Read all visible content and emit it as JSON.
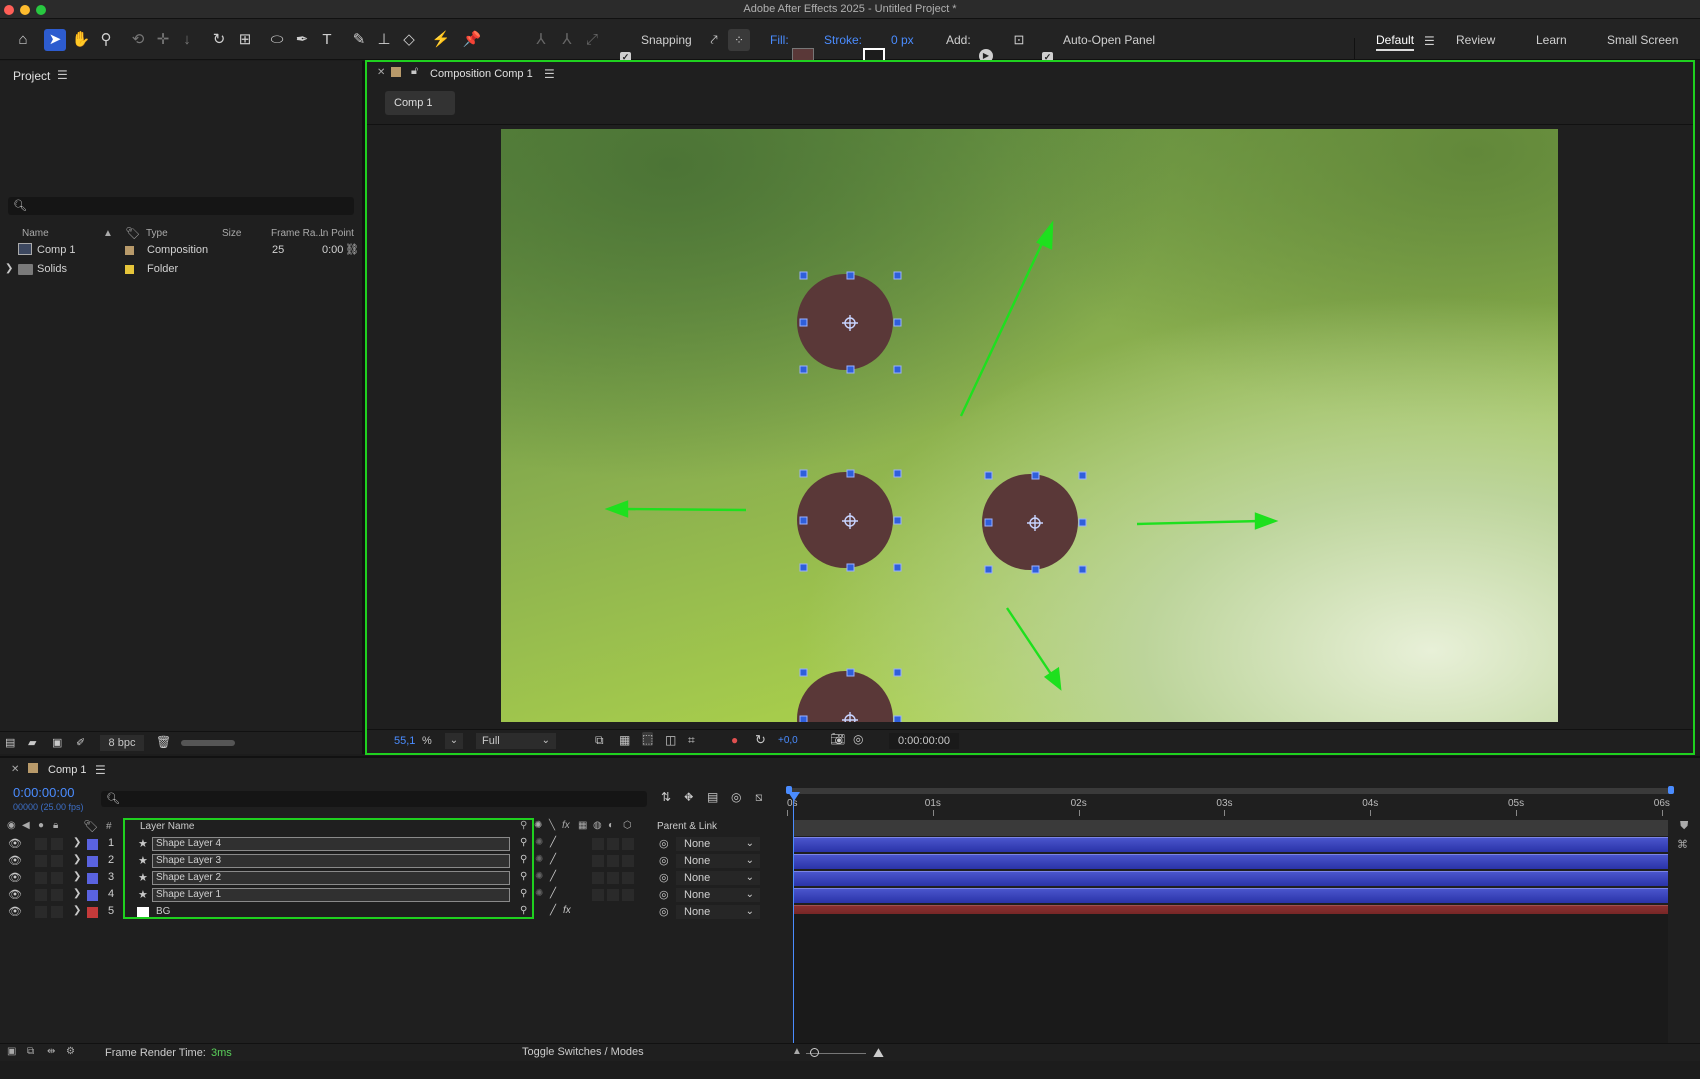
{
  "app": {
    "title": "Adobe After Effects 2025 - Untitled Project *"
  },
  "toolbar": {
    "snapping_label": "Snapping",
    "fill_label": "Fill:",
    "stroke_label": "Stroke:",
    "stroke_width": "0 px",
    "add_label": "Add:",
    "auto_open_label": "Auto-Open Panel",
    "fill_color": "#5a3838"
  },
  "workspaces": [
    "Default",
    "Review",
    "Learn",
    "Small Screen"
  ],
  "project": {
    "panel_title": "Project",
    "columns": {
      "name": "Name",
      "type": "Type",
      "size": "Size",
      "frame_rate": "Frame Ra...",
      "in_point": "In Point"
    },
    "items": [
      {
        "name": "Comp 1",
        "type": "Composition",
        "frame_rate": "25",
        "in_point": "0:00",
        "label_color": "#b89a6a"
      },
      {
        "name": "Solids",
        "type": "Folder",
        "frame_rate": "",
        "in_point": "",
        "label_color": "#e6c53a"
      }
    ],
    "bpc": "8 bpc"
  },
  "composition": {
    "tab_title": "Composition Comp 1",
    "breadcrumb": "Comp 1",
    "zoom": "55,1",
    "zoom_unit": "%",
    "resolution": "Full",
    "exposure": "+0,0",
    "timecode": "0:00:00:00"
  },
  "timeline": {
    "tab_title": "Comp 1",
    "current_time": "0:00:00:00",
    "frame_info": "00000 (25.00 fps)",
    "columns": {
      "num": "#",
      "layer_name": "Layer Name",
      "parent": "Parent & Link"
    },
    "ruler": [
      "0s",
      "01s",
      "02s",
      "03s",
      "04s",
      "05s",
      "06s"
    ],
    "layers": [
      {
        "num": "1",
        "name": "Shape Layer 4",
        "parent": "None",
        "color": "#5a63e0"
      },
      {
        "num": "2",
        "name": "Shape Layer 3",
        "parent": "None",
        "color": "#5a63e0"
      },
      {
        "num": "3",
        "name": "Shape Layer 2",
        "parent": "None",
        "color": "#5a63e0"
      },
      {
        "num": "4",
        "name": "Shape Layer 1",
        "parent": "None",
        "color": "#5a63e0"
      },
      {
        "num": "5",
        "name": "BG",
        "parent": "None",
        "color": "#c43a3a"
      }
    ],
    "render_time_label": "Frame Render Time:",
    "render_time_value": "3ms",
    "toggle_label": "Toggle Switches / Modes"
  }
}
